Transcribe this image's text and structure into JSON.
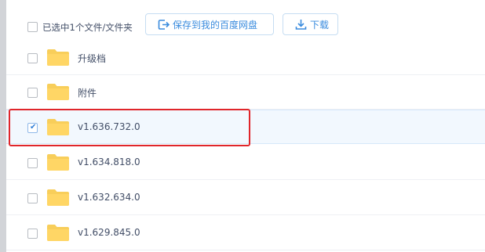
{
  "toolbar": {
    "select_label": "已选中1个文件/文件夹",
    "save_label": "保存到我的百度网盘",
    "download_label": "下载",
    "accent_color": "#3b8cde"
  },
  "files": [
    {
      "name": "升级档",
      "checked": false,
      "icon": "folder-icon"
    },
    {
      "name": "附件",
      "checked": false,
      "icon": "folder-icon"
    },
    {
      "name": "v1.636.732.0",
      "checked": true,
      "icon": "folder-icon"
    },
    {
      "name": "v1.634.818.0",
      "checked": false,
      "icon": "folder-icon"
    },
    {
      "name": "v1.632.634.0",
      "checked": false,
      "icon": "folder-icon"
    },
    {
      "name": "v1.629.845.0",
      "checked": false,
      "icon": "folder-icon"
    }
  ],
  "colors": {
    "folder": "#f8ce5a",
    "selected_row": "#f2f8fe",
    "annotation_box": "#e0262b"
  }
}
